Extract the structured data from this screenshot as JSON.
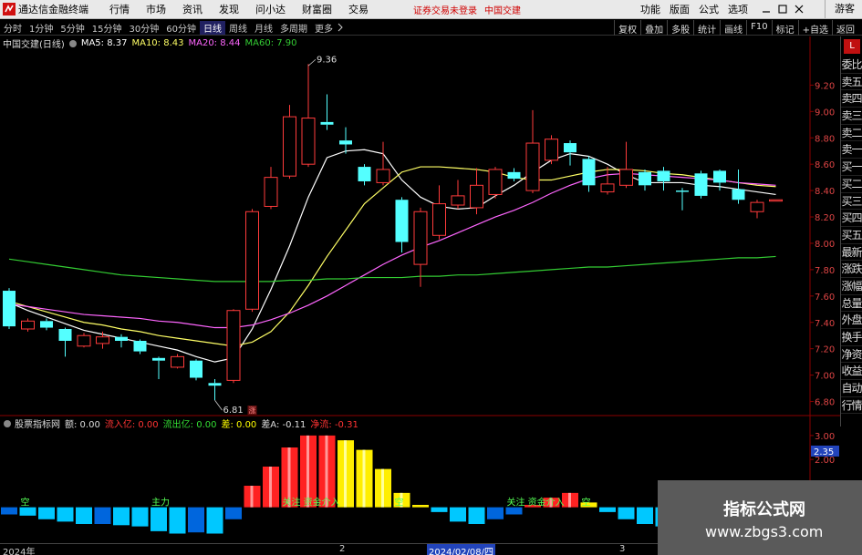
{
  "window": {
    "app_title": "通达信金融终端",
    "menu": [
      "行情",
      "市场",
      "资讯",
      "发现",
      "问小达",
      "财富圈",
      "交易"
    ],
    "login_notice": "证券交易未登录",
    "login_stock": "中国交建",
    "right_menu": [
      "功能",
      "版面",
      "公式",
      "选项"
    ],
    "guest": "游客"
  },
  "period_bar": {
    "periods": [
      "分时",
      "1分钟",
      "5分钟",
      "15分钟",
      "30分钟",
      "60分钟",
      "日线",
      "周线",
      "月线",
      "多周期",
      "更多"
    ],
    "active": "日线",
    "tools": [
      "复权",
      "叠加",
      "多股",
      "统计",
      "画线",
      "F10",
      "标记",
      "+自选",
      "返回"
    ]
  },
  "main_legend": {
    "stock": "中国交建(日线)",
    "items": [
      {
        "text": "MA5: 8.37",
        "color": "#ffffff"
      },
      {
        "text": "MA10: 8.43",
        "color": "#ffff66"
      },
      {
        "text": "MA20: 8.44",
        "color": "#ff66ff"
      },
      {
        "text": "MA60: 7.90",
        "color": "#33cc33"
      }
    ]
  },
  "indicator_legend": {
    "items": [
      {
        "text": "股票指标网",
        "color": "#dddddd"
      },
      {
        "text": "额: 0.00",
        "color": "#dddddd"
      },
      {
        "text": "流入亿: 0.00",
        "color": "#ff3333"
      },
      {
        "text": "流出亿: 0.00",
        "color": "#33dd33"
      },
      {
        "text": "差: 0.00",
        "color": "#ffff00"
      },
      {
        "text": "差A: -0.11",
        "color": "#dddddd"
      },
      {
        "text": "净流: -0.31",
        "color": "#ff3333"
      }
    ]
  },
  "sidebar": {
    "badge": "L",
    "tabs": [
      "委比",
      "卖五",
      "卖四",
      "卖三",
      "卖二",
      "卖一",
      "买一",
      "买二",
      "买三",
      "买四",
      "买五",
      "最新",
      "涨跌",
      "涨幅",
      "总量",
      "外盘",
      "换手",
      "净资",
      "收益",
      "自动",
      "行情"
    ]
  },
  "chart_data": {
    "type": "candlestick",
    "y_ticks": [
      "9.20",
      "9.00",
      "8.80",
      "8.60",
      "8.40",
      "8.20",
      "8.00",
      "7.80",
      "7.60",
      "7.40",
      "7.20",
      "7.00",
      "6.80"
    ],
    "ylim": [
      6.7,
      9.5
    ],
    "candles": [
      {
        "o": 7.64,
        "c": 7.37,
        "h": 7.66,
        "l": 7.35
      },
      {
        "o": 7.35,
        "c": 7.41,
        "h": 7.43,
        "l": 7.33
      },
      {
        "o": 7.41,
        "c": 7.36,
        "h": 7.43,
        "l": 7.34
      },
      {
        "o": 7.35,
        "c": 7.26,
        "h": 7.36,
        "l": 7.14
      },
      {
        "o": 7.22,
        "c": 7.3,
        "h": 7.32,
        "l": 7.21
      },
      {
        "o": 7.24,
        "c": 7.29,
        "h": 7.33,
        "l": 7.2
      },
      {
        "o": 7.29,
        "c": 7.26,
        "h": 7.31,
        "l": 7.21
      },
      {
        "o": 7.26,
        "c": 7.18,
        "h": 7.27,
        "l": 7.16
      },
      {
        "o": 7.13,
        "c": 7.11,
        "h": 7.14,
        "l": 6.97
      },
      {
        "o": 7.06,
        "c": 7.14,
        "h": 7.16,
        "l": 7.05
      },
      {
        "o": 7.11,
        "c": 6.98,
        "h": 7.12,
        "l": 6.96
      },
      {
        "o": 6.94,
        "c": 6.92,
        "h": 6.97,
        "l": 6.81
      },
      {
        "o": 6.96,
        "c": 7.49,
        "h": 7.5,
        "l": 6.94
      },
      {
        "o": 7.5,
        "c": 8.24,
        "h": 8.26,
        "l": 7.48
      },
      {
        "o": 8.28,
        "c": 8.5,
        "h": 8.58,
        "l": 8.26
      },
      {
        "o": 8.51,
        "c": 8.96,
        "h": 9.05,
        "l": 8.49
      },
      {
        "o": 8.6,
        "c": 8.95,
        "h": 9.36,
        "l": 8.58
      },
      {
        "o": 8.92,
        "c": 8.9,
        "h": 9.13,
        "l": 8.86
      },
      {
        "o": 8.78,
        "c": 8.75,
        "h": 8.88,
        "l": 8.68
      },
      {
        "o": 8.58,
        "c": 8.47,
        "h": 8.6,
        "l": 8.44
      },
      {
        "o": 8.46,
        "c": 8.56,
        "h": 8.77,
        "l": 8.44
      },
      {
        "o": 8.33,
        "c": 8.01,
        "h": 8.35,
        "l": 7.93
      },
      {
        "o": 7.84,
        "c": 8.24,
        "h": 8.27,
        "l": 7.67
      },
      {
        "o": 8.06,
        "c": 8.3,
        "h": 8.44,
        "l": 8.03
      },
      {
        "o": 8.29,
        "c": 8.36,
        "h": 8.48,
        "l": 8.26
      },
      {
        "o": 8.27,
        "c": 8.44,
        "h": 8.57,
        "l": 8.22
      },
      {
        "o": 8.37,
        "c": 8.56,
        "h": 8.58,
        "l": 8.34
      },
      {
        "o": 8.54,
        "c": 8.49,
        "h": 8.57,
        "l": 8.47
      },
      {
        "o": 8.4,
        "c": 8.76,
        "h": 9.01,
        "l": 8.38
      },
      {
        "o": 8.63,
        "c": 8.79,
        "h": 8.82,
        "l": 8.6
      },
      {
        "o": 8.76,
        "c": 8.69,
        "h": 8.78,
        "l": 8.59
      },
      {
        "o": 8.64,
        "c": 8.44,
        "h": 8.66,
        "l": 8.39
      },
      {
        "o": 8.39,
        "c": 8.45,
        "h": 8.58,
        "l": 8.37
      },
      {
        "o": 8.44,
        "c": 8.56,
        "h": 8.77,
        "l": 8.42
      },
      {
        "o": 8.54,
        "c": 8.44,
        "h": 8.56,
        "l": 8.4
      },
      {
        "o": 8.55,
        "c": 8.47,
        "h": 8.58,
        "l": 8.4
      },
      {
        "o": 8.4,
        "c": 8.39,
        "h": 8.42,
        "l": 8.25
      },
      {
        "o": 8.53,
        "c": 8.36,
        "h": 8.55,
        "l": 8.34
      },
      {
        "o": 8.55,
        "c": 8.46,
        "h": 8.56,
        "l": 8.4
      },
      {
        "o": 8.41,
        "c": 8.33,
        "h": 8.56,
        "l": 8.3
      },
      {
        "o": 8.24,
        "c": 8.31,
        "h": 8.33,
        "l": 8.19
      },
      {
        "o": 8.32,
        "c": 8.33,
        "h": 8.33,
        "l": 8.32
      }
    ],
    "ma": [
      {
        "name": "MA5",
        "color": "#ffffff",
        "values": [
          7.55,
          7.49,
          7.44,
          7.39,
          7.34,
          7.31,
          7.28,
          7.25,
          7.22,
          7.19,
          7.14,
          7.1,
          7.13,
          7.35,
          7.65,
          7.98,
          8.35,
          8.65,
          8.7,
          8.71,
          8.68,
          8.48,
          8.35,
          8.28,
          8.26,
          8.27,
          8.36,
          8.44,
          8.54,
          8.63,
          8.68,
          8.66,
          8.6,
          8.52,
          8.46,
          8.46,
          8.46,
          8.44,
          8.43,
          8.41,
          8.39,
          8.37
        ]
      },
      {
        "name": "MA10",
        "color": "#ffff66",
        "values": [
          7.56,
          7.52,
          7.48,
          7.44,
          7.4,
          7.38,
          7.35,
          7.33,
          7.3,
          7.28,
          7.26,
          7.24,
          7.22,
          7.25,
          7.33,
          7.48,
          7.68,
          7.9,
          8.1,
          8.3,
          8.42,
          8.54,
          8.58,
          8.58,
          8.57,
          8.56,
          8.54,
          8.5,
          8.48,
          8.48,
          8.51,
          8.54,
          8.56,
          8.56,
          8.55,
          8.53,
          8.52,
          8.5,
          8.48,
          8.46,
          8.44,
          8.43
        ]
      },
      {
        "name": "MA20",
        "color": "#ff66ff",
        "values": [
          7.54,
          7.52,
          7.5,
          7.48,
          7.46,
          7.45,
          7.44,
          7.43,
          7.41,
          7.4,
          7.38,
          7.36,
          7.36,
          7.38,
          7.42,
          7.47,
          7.53,
          7.6,
          7.68,
          7.76,
          7.84,
          7.91,
          7.97,
          8.02,
          8.08,
          8.14,
          8.2,
          8.25,
          8.31,
          8.38,
          8.44,
          8.49,
          8.52,
          8.53,
          8.52,
          8.51,
          8.5,
          8.49,
          8.48,
          8.46,
          8.45,
          8.44
        ]
      },
      {
        "name": "MA60",
        "color": "#33cc33",
        "values": [
          7.88,
          7.86,
          7.84,
          7.82,
          7.8,
          7.78,
          7.76,
          7.75,
          7.74,
          7.73,
          7.72,
          7.71,
          7.71,
          7.71,
          7.71,
          7.72,
          7.72,
          7.73,
          7.73,
          7.74,
          7.74,
          7.74,
          7.75,
          7.75,
          7.76,
          7.76,
          7.77,
          7.78,
          7.79,
          7.8,
          7.81,
          7.82,
          7.82,
          7.83,
          7.84,
          7.85,
          7.86,
          7.87,
          7.88,
          7.89,
          7.89,
          7.9
        ]
      }
    ],
    "annotations": [
      {
        "text": "9.36",
        "index": 16,
        "value": 9.36
      },
      {
        "text": "6.81",
        "index": 11,
        "value": 6.81
      }
    ],
    "event_marker": {
      "text": "涨",
      "index": 13
    },
    "indicator": {
      "y_ticks": [
        "3.00",
        "2.00"
      ],
      "ylim": [
        -1.5,
        3.3
      ],
      "current_value": "2.35",
      "values": [
        -0.3,
        -0.35,
        -0.5,
        -0.6,
        -0.7,
        -0.7,
        -0.75,
        -0.8,
        -1.0,
        -1.1,
        -1.05,
        -1.1,
        -0.5,
        0.9,
        1.7,
        2.5,
        3.0,
        3.0,
        2.8,
        2.4,
        1.6,
        0.6,
        0.1,
        -0.2,
        -0.6,
        -0.7,
        -0.5,
        -0.3,
        0.1,
        0.4,
        0.6,
        0.2,
        -0.2,
        -0.5,
        -0.7,
        -0.8,
        -0.6,
        -0.5,
        -0.4,
        -0.3,
        -0.3,
        -0.3
      ],
      "labels": [
        {
          "text": "空",
          "index": 1
        },
        {
          "text": "主力",
          "index": 8
        },
        {
          "text": "关注 资金介入",
          "index": 15
        },
        {
          "text": "空",
          "index": 21
        },
        {
          "text": "关注 资金介入",
          "index": 27
        },
        {
          "text": "空",
          "index": 31
        }
      ]
    }
  },
  "time_axis": {
    "labels": [
      {
        "text": "2024年",
        "index": 0
      },
      {
        "text": "2",
        "index": 18
      },
      {
        "text": "2024/02/08/四",
        "index": 23
      },
      {
        "text": "3",
        "index": 33
      }
    ]
  },
  "watermark": {
    "title": "指标公式网",
    "url": "www.zbgs3.com"
  }
}
